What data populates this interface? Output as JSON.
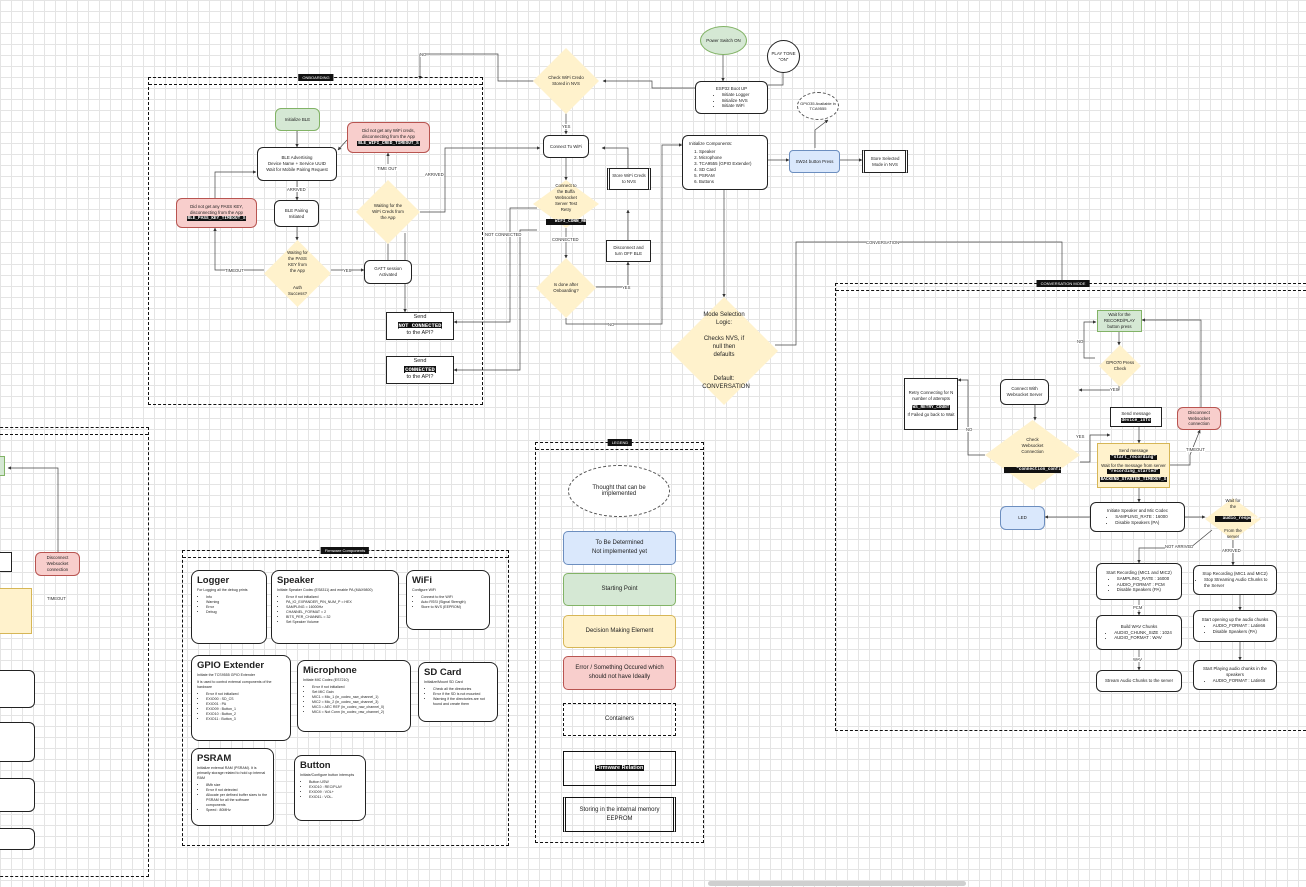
{
  "containers": {
    "onboarding": "ONBOARDING",
    "conversation": "CONVERSATION MODE",
    "firmware_components": "Firmware Components",
    "legend": "LEGEND"
  },
  "main": {
    "power": "Power Switch ON",
    "play_tone": "PLAY TONE \"ON\"",
    "esp32_boot": "ESP32 Boot UP",
    "esp32_steps": [
      "Initiate Logger",
      "Initialize NVS",
      "Initiate WiFi"
    ],
    "check_wifi": "Check WiFi Credo Stored in NVS",
    "connect_wifi": "Connect To WiFi",
    "connect_backend": "Connect to the Buffa Websocket Server Test Retry",
    "wifi_conn_retry": "WIFI_CONN_RETRY",
    "is_done_onboarding": "Is done after Onboarding?",
    "store_wifi": "Store WiFi Creds to NVS",
    "disconnect_ble": "Disconnect and turn OFF BLE",
    "init_components_title": "Initialize Components:",
    "init_components": [
      "Speaker",
      "Microphone",
      "TCA9555 (GPIO Extender)",
      "SD Card",
      "PSRAM",
      "Buttons"
    ],
    "sw_button": "SW24 button Press",
    "gpio_available": "GPIO35 Available in TCA9555",
    "store_mode": "Store Selected Mode in NVS",
    "mode_selection_line1": "Mode Selection Logic:",
    "mode_selection_line2": "Checks NVS, if null then defaults",
    "mode_selection_line3": "Default: CONVERSATION",
    "labels": {
      "no": "NO",
      "yes": "YES",
      "connected": "CONNECTED",
      "not_connected": "NOT CONNECTED",
      "conversation": "CONVERSATION"
    }
  },
  "onboarding": {
    "init_ble": "Initialize BLE",
    "ble_advertising": "BLE Advertising",
    "ble_device_name": "Device Name + Service UUID",
    "ble_wait": "Wait for Mobile Pairing Request",
    "no_wifi_creds": "Did not get any WiFi creds, disconnecting from the App",
    "ble_wifi_timeout": "BLE_WIFI_CRED_TIMEOUT_S",
    "no_pass_key": "Did not get any PASS KEY, disconnecting from the App",
    "ble_pass_timeout": "BLE_PASS_KEY_TIMEOUT_S",
    "ble_pairing": "BLE Pairing Initiated",
    "waiting_pass_key": "Waiting for the PASS KEY from the App",
    "auth_success": "Auth Success?",
    "gatt_session": "GATT session Activated",
    "waiting_wifi_creds": "Waiting for the WiFi Creds from the App",
    "send": "Send",
    "not_connected_caps": "NOT CONNECTED",
    "connected_caps": "CONNECTED",
    "to_app": "to the API?",
    "labels": {
      "arrived": "ARRIVED",
      "timeout": "TIMEOUT",
      "time_out": "TIME OUT",
      "yes": "YES"
    }
  },
  "conversation": {
    "wait_record": "Wait for the RECORD/PLAY button press",
    "gpio_check": "GPIO70 Press Check",
    "retry_connect": "Retry Connecting for N number of attempts",
    "retry_count": "WS_RETRY_COUNT",
    "retry_failed": "If Failed go back to Wait",
    "connect_ws": "Connect With Websocket Server",
    "disconnect_ws": "Disconnect Websocket connection",
    "send_message1": "Send message",
    "device_info": "device_info",
    "check_ws": "Check Websocket Connection",
    "connection_confirmed": "\"connection_confirmed\"",
    "send_message2": "Send message",
    "start_recording": "\"start_recording\"",
    "wait_backend": "Wait for the message from server",
    "recording_started": "\"recording_started\"",
    "backend_timeout": "BACKEND_STARTED_TIMEOUT_S",
    "led": "LED",
    "init_speaker_mic": "Initiate Speaker and Mic Codec",
    "init_speaker_mic_items": [
      "SAMPLING_RATE : 16000",
      "Disable Speakers (PA)"
    ],
    "wait_audio": "Wait for the",
    "audio_response": "audio_response",
    "wait_audio2": "From the server",
    "start_recording_box": "Start Recording (MIC1 and MIC2)",
    "start_recording_items": [
      "SAMPLING_RATE : 16000",
      "AUDIO_FORMAT : PCM",
      "Disable Speakers (PA)"
    ],
    "build_wav": "Build WAV Chunks",
    "build_wav_items": [
      "AUDIO_CHUNK_SIZE : 1024",
      "AUDIO_FORMAT : WAV"
    ],
    "stream_chunks": "Stream Audio Chunks to the server",
    "stop_recording": "Stop Recording (MIC1 and MIC2)",
    "stop_recording_items": [
      "Stop Streaming Audio Chunks to the Server"
    ],
    "start_opening": "Start opening up the audio chunks",
    "start_opening_items": [
      "AUDIO_FORMAT : Latin66",
      "Disable Speakers (PA)"
    ],
    "start_playing": "Start Playing audio chunks in the speakers",
    "start_playing_items": [
      "AUDIO_FORMAT : Latin66"
    ],
    "labels": {
      "no": "NO",
      "yes": "YES",
      "arrived": "ARRIVED",
      "not_arrived": "NOT ARRIVED",
      "timeout": "TIMEOUT",
      "pcm": "PCM",
      "wav": "WAV"
    }
  },
  "firmware": {
    "logger_title": "Logger",
    "logger_desc": "For Logging all the debug prints",
    "logger_items": [
      "Info",
      "Warning",
      "Error",
      "Debug"
    ],
    "speaker_title": "Speaker",
    "speaker_desc": "Initiate Speaker Codec (ES8311) and enable PA (MAX9800)",
    "speaker_items": [
      "Error if not initialized",
      "PA_IO_EXPANDER_PIN_NUM_P = HEX",
      "SAMPLING = 16000Hz",
      "CHANNEL_FORMAT = 2",
      "BITS_PER_CHANNEL = 32",
      "Set Speaker Volume"
    ],
    "wifi_title": "WiFi",
    "wifi_desc": "Configure WiFi",
    "wifi_items": [
      "Connect to the WiFi",
      "Auto RSSI (Signal Strength)",
      "Store to NVS (EEPROM)"
    ],
    "gpio_title": "GPIO Extender",
    "gpio_desc": "Initiate the TCS9555 GPIO Extender",
    "gpio_desc2": "It is used to control external components of the hardware",
    "gpio_items": [
      "Error if not initialized",
      "EXIO00 : SD_CS",
      "EXIO01 : PA",
      "EXIO09 : Button_1",
      "EXIO10 : Button_2",
      "EXIO11 : Button_3"
    ],
    "mic_title": "Microphone",
    "mic_desc": "Initiate MIC Codec (ES7210)",
    "mic_items": [
      "Error if not initialized",
      "Set MIC Gain",
      "MIC1 = Mic_1 (in_codec_raw_channel_1)",
      "MIC2 = Mic_2 (in_codec_raw_channel_3)",
      "MIC3 = AEC REF (in_codec_raw_channel_0)",
      "MIC4 = Not Conn (in_codec_raw_channel_2)"
    ],
    "sd_title": "SD Card",
    "sd_desc": "Initialize/Mount SD Card",
    "sd_items": [
      "Check all the directories",
      "Error if the SD is not mounted",
      "Warning if the directories are not found and create them"
    ],
    "psram_title": "PSRAM",
    "psram_desc": "Initialize external RAM (PSRAM). It is primarily storage related to hold up internal RAM",
    "psram_items": [
      "8Mb size",
      "Error if not detected",
      "Allocate per defined buffer sizes to the PSRAM for all the software components",
      "Speed : 80MHz"
    ],
    "button_title": "Button",
    "button_desc": "Initiate/Configure button interrupts",
    "button_items": [
      "Button USW",
      "EXIO10 : REC/PLAY",
      "EXIO09 : VOL+",
      "EXIO11 : VOL-"
    ]
  },
  "legend": {
    "thought": "Thought that can be implemented",
    "tbd1": "To Be Determined",
    "tbd2": "Not implemented yet",
    "starting": "Starting Point",
    "decision": "Decision Making Element",
    "error": "Error / Something Occured which should not have Ideally",
    "containers": "Containers",
    "firmware_relation": "Firmware Relation",
    "storing": "Storing in the internal memory EEPROM"
  },
  "left_partial": {
    "disconnect_ws": "Disconnect Websocket connection",
    "timeout": "TIMEOUT"
  }
}
